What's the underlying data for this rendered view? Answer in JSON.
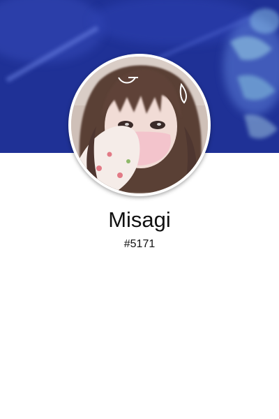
{
  "profile": {
    "username": "Misagi",
    "discriminator": "#5171",
    "banner_icon": "blurred-blue-banner-image",
    "avatar_icon": "profile-photo"
  },
  "colors": {
    "banner": "#2236a0",
    "avatar_border": "#ffffff",
    "text": "#111111",
    "background": "#ffffff"
  }
}
